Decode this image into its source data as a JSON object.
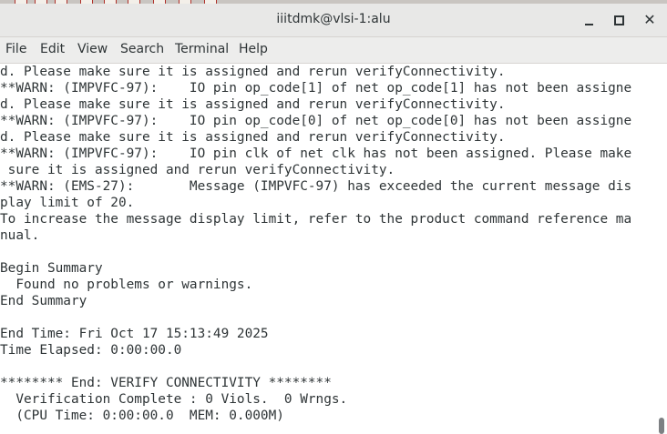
{
  "window": {
    "title": "iiitdmk@vlsi-1:alu"
  },
  "menubar": {
    "items": [
      "File",
      "Edit",
      "View",
      "Search",
      "Terminal",
      "Help"
    ]
  },
  "terminal": {
    "lines": [
      "d. Please make sure it is assigned and rerun verifyConnectivity.",
      "**WARN: (IMPVFC-97):    IO pin op_code[1] of net op_code[1] has not been assigne",
      "d. Please make sure it is assigned and rerun verifyConnectivity.",
      "**WARN: (IMPVFC-97):    IO pin op_code[0] of net op_code[0] has not been assigne",
      "d. Please make sure it is assigned and rerun verifyConnectivity.",
      "**WARN: (IMPVFC-97):    IO pin clk of net clk has not been assigned. Please make",
      " sure it is assigned and rerun verifyConnectivity.",
      "**WARN: (EMS-27):       Message (IMPVFC-97) has exceeded the current message dis",
      "play limit of 20.",
      "To increase the message display limit, refer to the product command reference ma",
      "nual.",
      "",
      "Begin Summary",
      "  Found no problems or warnings.",
      "End Summary",
      "",
      "End Time: Fri Oct 17 15:13:49 2025",
      "Time Elapsed: 0:00:00.0",
      "",
      "******** End: VERIFY CONNECTIVITY ********",
      "  Verification Complete : 0 Viols.  0 Wrngs.",
      "  (CPU Time: 0:00:00.0  MEM: 0.000M)"
    ]
  },
  "icons": {
    "minimize": "minimize-icon",
    "maximize": "maximize-icon",
    "close": "close-icon"
  },
  "colors": {
    "titlebar": "#e8e8e7",
    "menubar": "#ededec",
    "terminal_bg": "#ffffff",
    "terminal_fg": "#2e3436",
    "scrollbar_thumb": "#7d8083"
  }
}
